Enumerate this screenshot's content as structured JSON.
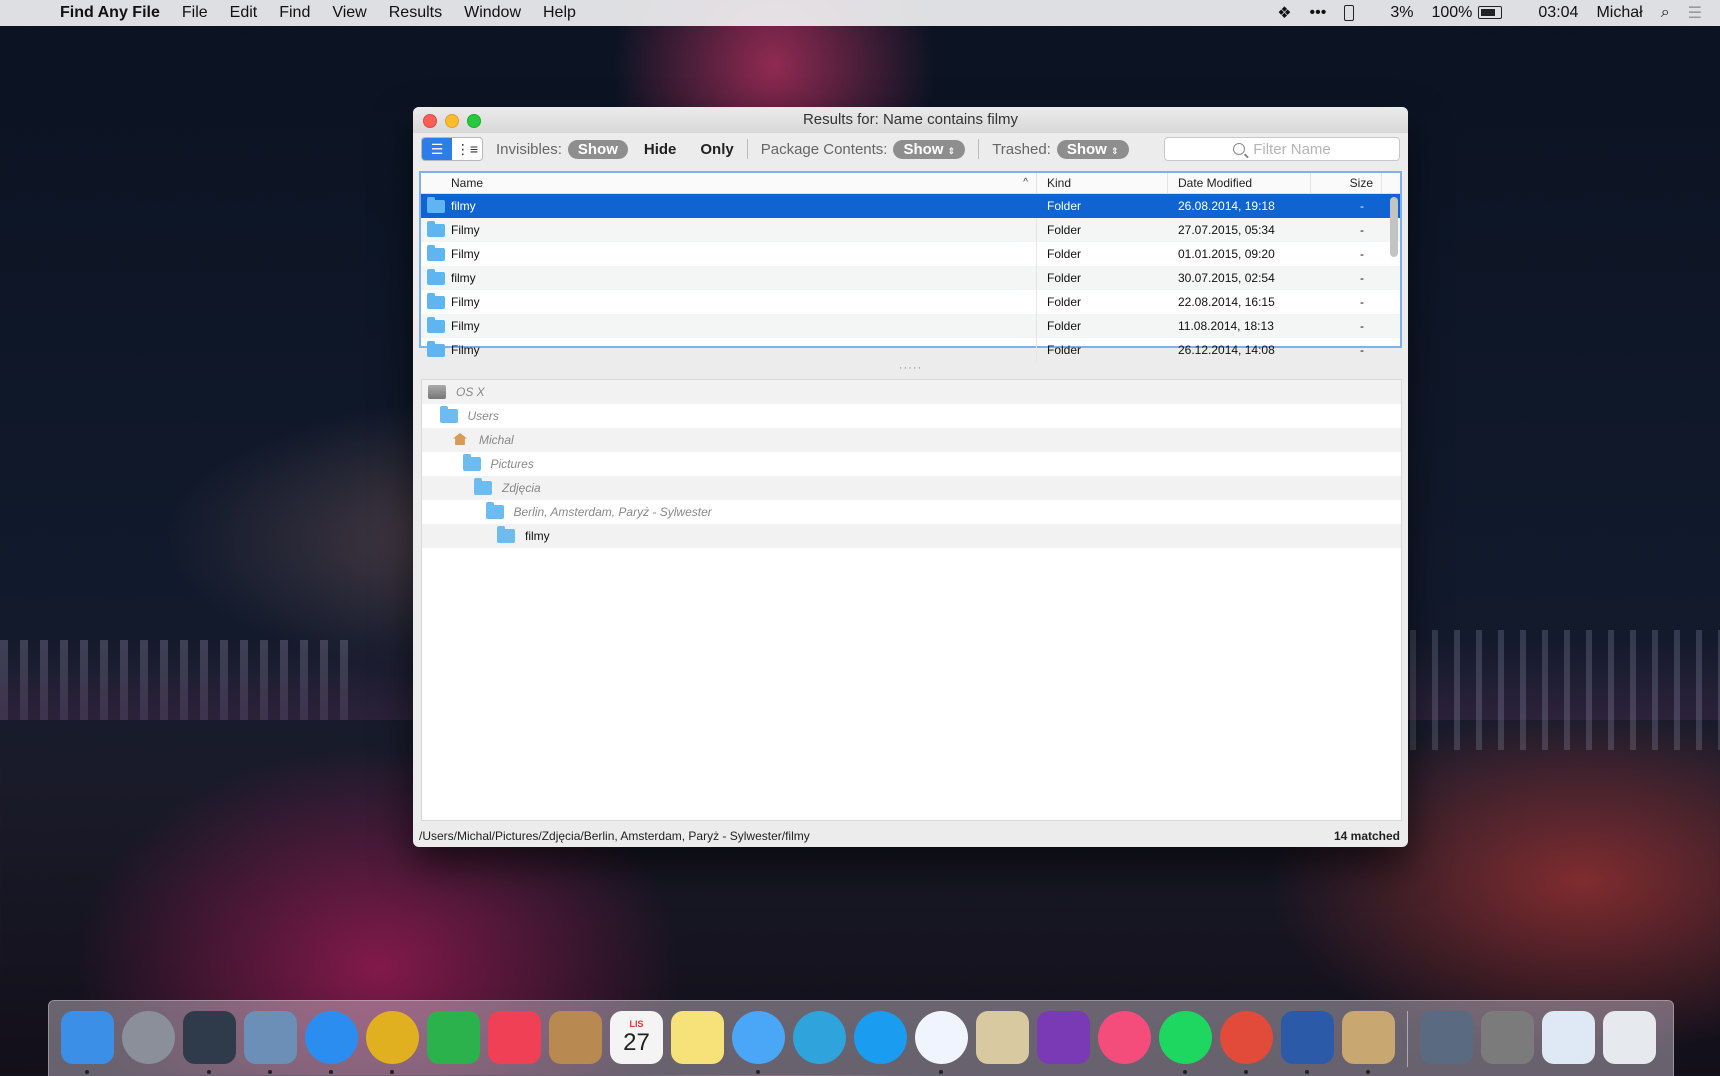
{
  "menubar": {
    "apple_icon": "apple-icon",
    "app_name": "Find Any File",
    "menus": [
      "File",
      "Edit",
      "Find",
      "View",
      "Results",
      "Window",
      "Help"
    ],
    "status": {
      "cpu": "3%",
      "battery": "100%",
      "time": "03:04",
      "user": "Michał"
    }
  },
  "window": {
    "title": "Results for: Name contains filmy",
    "toolbar": {
      "invisibles_label": "Invisibles:",
      "invisibles_show": "Show",
      "invisibles_hide": "Hide",
      "invisibles_only": "Only",
      "package_label": "Package Contents:",
      "package_value": "Show",
      "trashed_label": "Trashed:",
      "trashed_value": "Show",
      "filter_placeholder": "Filter Name"
    },
    "table": {
      "columns": {
        "name": "Name",
        "kind": "Kind",
        "date": "Date Modified",
        "size": "Size"
      },
      "rows": [
        {
          "name": "filmy",
          "kind": "Folder",
          "date": "26.08.2014, 19:18",
          "size": "-",
          "selected": true
        },
        {
          "name": "Filmy",
          "kind": "Folder",
          "date": "27.07.2015, 05:34",
          "size": "-"
        },
        {
          "name": "Filmy",
          "kind": "Folder",
          "date": "01.01.2015, 09:20",
          "size": "-"
        },
        {
          "name": "filmy",
          "kind": "Folder",
          "date": "30.07.2015, 02:54",
          "size": "-"
        },
        {
          "name": "Filmy",
          "kind": "Folder",
          "date": "22.08.2014, 16:15",
          "size": "-"
        },
        {
          "name": "Filmy",
          "kind": "Folder",
          "date": "11.08.2014, 18:13",
          "size": "-"
        },
        {
          "name": "Filmy",
          "kind": "Folder",
          "date": "26.12.2014, 14:08",
          "size": "-"
        }
      ]
    },
    "path_items": [
      {
        "label": "OS X",
        "icon": "disk-icon"
      },
      {
        "label": "Users",
        "icon": "users-folder-icon"
      },
      {
        "label": "Michal",
        "icon": "home-icon"
      },
      {
        "label": "Pictures",
        "icon": "pictures-folder-icon"
      },
      {
        "label": "Zdjęcia",
        "icon": "folder-icon"
      },
      {
        "label": "Berlin, Amsterdam, Paryż - Sylwester",
        "icon": "folder-icon"
      },
      {
        "label": "filmy",
        "icon": "folder-icon"
      }
    ],
    "status": {
      "path": "/Users/Michal/Pictures/Zdjęcia/Berlin, Amsterdam, Paryż - Sylwester/filmy",
      "count": "14 matched"
    }
  },
  "dock": {
    "apps": [
      {
        "name": "finder",
        "color": "#3b8fe6",
        "running": true
      },
      {
        "name": "launchpad",
        "color": "#8a8f9a",
        "running": false
      },
      {
        "name": "app-3",
        "color": "#2f3a4a",
        "running": true
      },
      {
        "name": "mail",
        "color": "#6c8fb8",
        "running": true
      },
      {
        "name": "safari",
        "color": "#2c8df0",
        "running": true
      },
      {
        "name": "chrome",
        "color": "#e0b020",
        "running": true
      },
      {
        "name": "feedly",
        "color": "#2bb24c",
        "running": false
      },
      {
        "name": "pocket",
        "color": "#ef4056",
        "running": false
      },
      {
        "name": "contacts",
        "color": "#b88a52",
        "running": false
      },
      {
        "name": "calendar",
        "color": "#f4f4f4",
        "running": false
      },
      {
        "name": "notes",
        "color": "#f7e27a",
        "running": false
      },
      {
        "name": "messages",
        "color": "#4aa6f7",
        "running": true
      },
      {
        "name": "telegram",
        "color": "#2ea3dc",
        "running": false
      },
      {
        "name": "skype",
        "color": "#1a9cf0",
        "running": false
      },
      {
        "name": "messenger",
        "color": "#f0f4ff",
        "running": true
      },
      {
        "name": "preview",
        "color": "#d9c9a0",
        "running": false
      },
      {
        "name": "onenote",
        "color": "#7b3ab5",
        "running": false
      },
      {
        "name": "itunes",
        "color": "#f44d7c",
        "running": false
      },
      {
        "name": "spotify",
        "color": "#1ed760",
        "running": true
      },
      {
        "name": "transmit",
        "color": "#e24a3a",
        "running": true
      },
      {
        "name": "word",
        "color": "#2b5ba8",
        "running": true
      },
      {
        "name": "find-any-file",
        "color": "#c8a870",
        "running": true
      }
    ],
    "stacks": [
      {
        "name": "stack-1",
        "color": "#5a6a80"
      },
      {
        "name": "stack-2",
        "color": "#7b7b7b"
      },
      {
        "name": "stack-3",
        "color": "#dfe8f5"
      },
      {
        "name": "trash",
        "color": "#e6e9ee"
      }
    ],
    "calendar_month": "LIS",
    "calendar_day": "27"
  }
}
